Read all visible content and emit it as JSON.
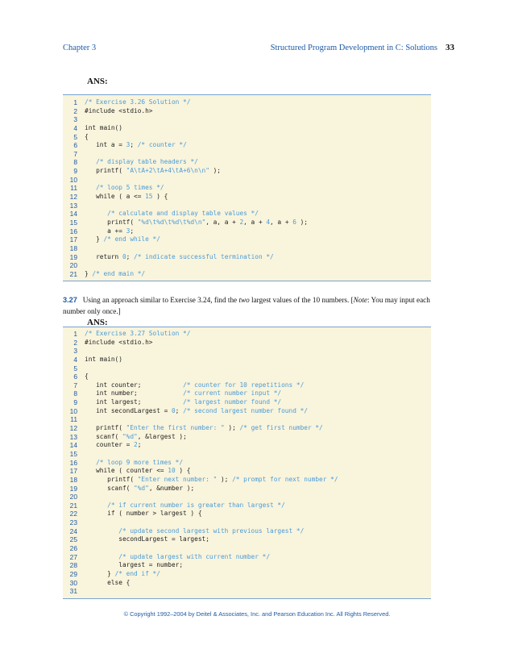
{
  "header": {
    "chapter": "Chapter 3",
    "title": "Structured Program Development in C: Solutions",
    "page_number": "33"
  },
  "ans_label_1": "ANS:",
  "code1": [
    {
      "n": "1",
      "t": [
        [
          "c",
          "/* Exercise 3.26 Solution */"
        ]
      ]
    },
    {
      "n": "2",
      "t": [
        [
          "p",
          "#include <stdio.h>"
        ]
      ]
    },
    {
      "n": "3",
      "t": []
    },
    {
      "n": "4",
      "t": [
        [
          "p",
          "int main()"
        ]
      ]
    },
    {
      "n": "5",
      "t": [
        [
          "p",
          "{"
        ]
      ]
    },
    {
      "n": "6",
      "t": [
        [
          "p",
          "   int a = "
        ],
        [
          "k",
          "3"
        ],
        [
          "p",
          "; "
        ],
        [
          "c",
          "/* counter */"
        ]
      ]
    },
    {
      "n": "7",
      "t": []
    },
    {
      "n": "8",
      "t": [
        [
          "p",
          "   "
        ],
        [
          "c",
          "/* display table headers */"
        ]
      ]
    },
    {
      "n": "9",
      "t": [
        [
          "p",
          "   printf( "
        ],
        [
          "s",
          "\"A\\tA+2\\tA+4\\tA+6\\n\\n\""
        ],
        [
          "p",
          " );"
        ]
      ]
    },
    {
      "n": "10",
      "t": []
    },
    {
      "n": "11",
      "t": [
        [
          "p",
          "   "
        ],
        [
          "c",
          "/* loop 5 times */"
        ]
      ]
    },
    {
      "n": "12",
      "t": [
        [
          "p",
          "   while ( a <= "
        ],
        [
          "k",
          "15"
        ],
        [
          "p",
          " ) {"
        ]
      ]
    },
    {
      "n": "13",
      "t": []
    },
    {
      "n": "14",
      "t": [
        [
          "p",
          "      "
        ],
        [
          "c",
          "/* calculate and display table values */"
        ]
      ]
    },
    {
      "n": "15",
      "t": [
        [
          "p",
          "      printf( "
        ],
        [
          "s",
          "\"%d\\t%d\\t%d\\t%d\\n\""
        ],
        [
          "p",
          ", a, a + "
        ],
        [
          "k",
          "2"
        ],
        [
          "p",
          ", a + "
        ],
        [
          "k",
          "4"
        ],
        [
          "p",
          ", a + "
        ],
        [
          "k",
          "6"
        ],
        [
          "p",
          " );"
        ]
      ]
    },
    {
      "n": "16",
      "t": [
        [
          "p",
          "      a += "
        ],
        [
          "k",
          "3"
        ],
        [
          "p",
          ";"
        ]
      ]
    },
    {
      "n": "17",
      "t": [
        [
          "p",
          "   } "
        ],
        [
          "c",
          "/* end while */"
        ]
      ]
    },
    {
      "n": "18",
      "t": []
    },
    {
      "n": "19",
      "t": [
        [
          "p",
          "   return "
        ],
        [
          "k",
          "0"
        ],
        [
          "p",
          "; "
        ],
        [
          "c",
          "/* indicate successful termination */"
        ]
      ]
    },
    {
      "n": "20",
      "t": []
    },
    {
      "n": "21",
      "t": [
        [
          "p",
          "} "
        ],
        [
          "c",
          "/* end main */"
        ]
      ]
    }
  ],
  "exercise": {
    "number": "3.27",
    "text_before": "Using an approach similar to Exercise 3.24, find the ",
    "italic_word": "two",
    "text_middle": " largest values of the 10 numbers. [",
    "note_word": "Note",
    "text_after": ": You may input each number only once.]"
  },
  "ans_label_2": "ANS:",
  "code2": [
    {
      "n": "1",
      "t": [
        [
          "c",
          "/* Exercise 3.27 Solution */"
        ]
      ]
    },
    {
      "n": "2",
      "t": [
        [
          "p",
          "#include <stdio.h>"
        ]
      ]
    },
    {
      "n": "3",
      "t": []
    },
    {
      "n": "4",
      "t": [
        [
          "p",
          "int main()"
        ]
      ]
    },
    {
      "n": "5",
      "t": []
    },
    {
      "n": "6",
      "t": [
        [
          "p",
          "{"
        ]
      ]
    },
    {
      "n": "7",
      "t": [
        [
          "p",
          "   int counter;           "
        ],
        [
          "c",
          "/* counter for 10 repetitions */"
        ]
      ]
    },
    {
      "n": "8",
      "t": [
        [
          "p",
          "   int number;            "
        ],
        [
          "c",
          "/* current number input */"
        ]
      ]
    },
    {
      "n": "9",
      "t": [
        [
          "p",
          "   int largest;           "
        ],
        [
          "c",
          "/* largest number found */"
        ]
      ]
    },
    {
      "n": "10",
      "t": [
        [
          "p",
          "   int secondLargest = "
        ],
        [
          "k",
          "0"
        ],
        [
          "p",
          "; "
        ],
        [
          "c",
          "/* second largest number found */"
        ]
      ]
    },
    {
      "n": "11",
      "t": []
    },
    {
      "n": "12",
      "t": [
        [
          "p",
          "   printf( "
        ],
        [
          "s",
          "\"Enter the first number: \""
        ],
        [
          "p",
          " ); "
        ],
        [
          "c",
          "/* get first number */"
        ]
      ]
    },
    {
      "n": "13",
      "t": [
        [
          "p",
          "   scanf( "
        ],
        [
          "s",
          "\"%d\""
        ],
        [
          "p",
          ", &largest );"
        ]
      ]
    },
    {
      "n": "14",
      "t": [
        [
          "p",
          "   counter = "
        ],
        [
          "k",
          "2"
        ],
        [
          "p",
          ";"
        ]
      ]
    },
    {
      "n": "15",
      "t": []
    },
    {
      "n": "16",
      "t": [
        [
          "p",
          "   "
        ],
        [
          "c",
          "/* loop 9 more times */"
        ]
      ]
    },
    {
      "n": "17",
      "t": [
        [
          "p",
          "   while ( counter <= "
        ],
        [
          "k",
          "10"
        ],
        [
          "p",
          " ) {"
        ]
      ]
    },
    {
      "n": "18",
      "t": [
        [
          "p",
          "      printf( "
        ],
        [
          "s",
          "\"Enter next number: \""
        ],
        [
          "p",
          " ); "
        ],
        [
          "c",
          "/* prompt for next number */"
        ]
      ]
    },
    {
      "n": "19",
      "t": [
        [
          "p",
          "      scanf( "
        ],
        [
          "s",
          "\"%d\""
        ],
        [
          "p",
          ", &number );"
        ]
      ]
    },
    {
      "n": "20",
      "t": []
    },
    {
      "n": "21",
      "t": [
        [
          "p",
          "      "
        ],
        [
          "c",
          "/* if current number is greater than largest */"
        ]
      ]
    },
    {
      "n": "22",
      "t": [
        [
          "p",
          "      if ( number > largest ) {"
        ]
      ]
    },
    {
      "n": "23",
      "t": []
    },
    {
      "n": "24",
      "t": [
        [
          "p",
          "         "
        ],
        [
          "c",
          "/* update second largest with previous largest */"
        ]
      ]
    },
    {
      "n": "25",
      "t": [
        [
          "p",
          "         secondLargest = largest;"
        ]
      ]
    },
    {
      "n": "26",
      "t": []
    },
    {
      "n": "27",
      "t": [
        [
          "p",
          "         "
        ],
        [
          "c",
          "/* update largest with current number */"
        ]
      ]
    },
    {
      "n": "28",
      "t": [
        [
          "p",
          "         largest = number;"
        ]
      ]
    },
    {
      "n": "29",
      "t": [
        [
          "p",
          "      } "
        ],
        [
          "c",
          "/* end if */"
        ]
      ]
    },
    {
      "n": "30",
      "t": [
        [
          "p",
          "      else {"
        ]
      ]
    },
    {
      "n": "31",
      "t": []
    }
  ],
  "footer": "© Copyright 1992–2004 by Deitel & Associates, Inc. and Pearson Education Inc. All Rights Reserved."
}
